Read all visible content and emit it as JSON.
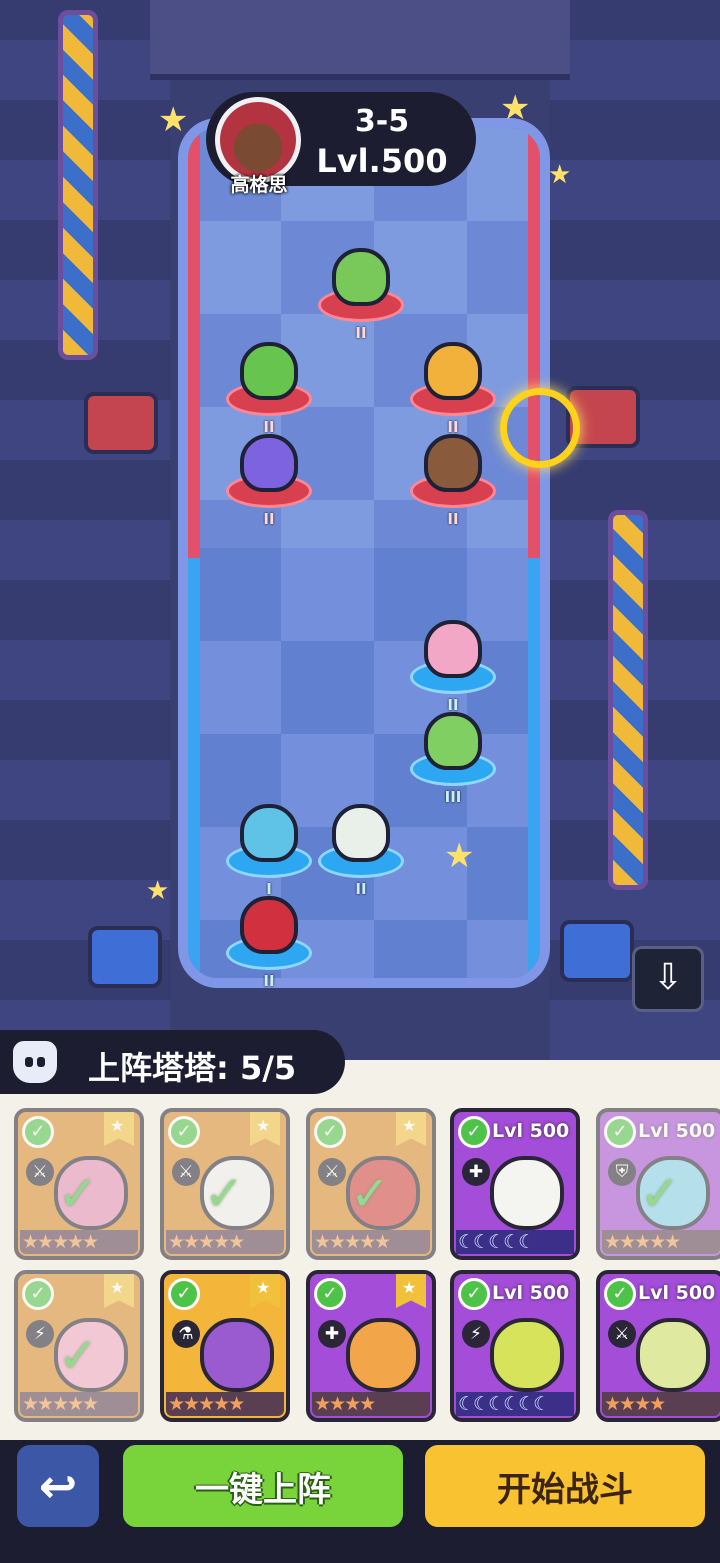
{
  "opponent": {
    "name": "高格思",
    "stage": "3-5",
    "level": "Lvl.500"
  },
  "board": {
    "enemy_units": [
      {
        "rank": "II",
        "color": "#79c95a"
      },
      {
        "rank": "II",
        "color": "#67c44e"
      },
      {
        "rank": "II",
        "color": "#f2b13a"
      },
      {
        "rank": "II",
        "color": "#7d63e0"
      },
      {
        "rank": "II",
        "color": "#8a5a3c"
      }
    ],
    "ally_units": [
      {
        "rank": "II",
        "color": "#f3a7c6"
      },
      {
        "rank": "III",
        "color": "#7fcf62"
      },
      {
        "rank": "I",
        "color": "#5fc3e8"
      },
      {
        "rank": "II",
        "color": "#e9efe9"
      },
      {
        "rank": "II",
        "color": "#d1313f"
      }
    ]
  },
  "deploy": {
    "label": "上阵塔塔: 5/5"
  },
  "cards": [
    {
      "variant": "gold",
      "level": "",
      "deployed": true,
      "stars": "★★★★★",
      "color": "#e58fb7"
    },
    {
      "variant": "gold",
      "level": "",
      "deployed": true,
      "stars": "★★★★★",
      "color": "#f0f0f0"
    },
    {
      "variant": "gold",
      "level": "",
      "deployed": true,
      "stars": "★★★★★",
      "color": "#d14040"
    },
    {
      "variant": "purple",
      "level": "Lvl 500",
      "deployed": false,
      "stars": "☾☾☾☾☾",
      "color": "#f4f4f0"
    },
    {
      "variant": "purple",
      "level": "Lvl 500",
      "deployed": true,
      "stars": "★★★★★",
      "color": "#82d3ef"
    },
    {
      "variant": "gold",
      "level": "",
      "deployed": true,
      "stars": "★★★★★",
      "color": "#f3a7c6"
    },
    {
      "variant": "yellow",
      "level": "",
      "deployed": false,
      "stars": "★★★★★",
      "color": "#9b5bd0"
    },
    {
      "variant": "purple",
      "level": "",
      "deployed": false,
      "stars": "★★★★",
      "color": "#f3a54a"
    },
    {
      "variant": "purple",
      "level": "Lvl 500",
      "deployed": false,
      "stars": "☾☾☾☾☾☾",
      "color": "#d7e35a"
    },
    {
      "variant": "purple",
      "level": "Lvl 500",
      "deployed": false,
      "stars": "★★★★",
      "color": "#dfe9a0"
    }
  ],
  "buttons": {
    "back_icon": "↩",
    "auto_deploy": "一键上阵",
    "start_battle": "开始战斗",
    "download_icon": "⇩"
  }
}
